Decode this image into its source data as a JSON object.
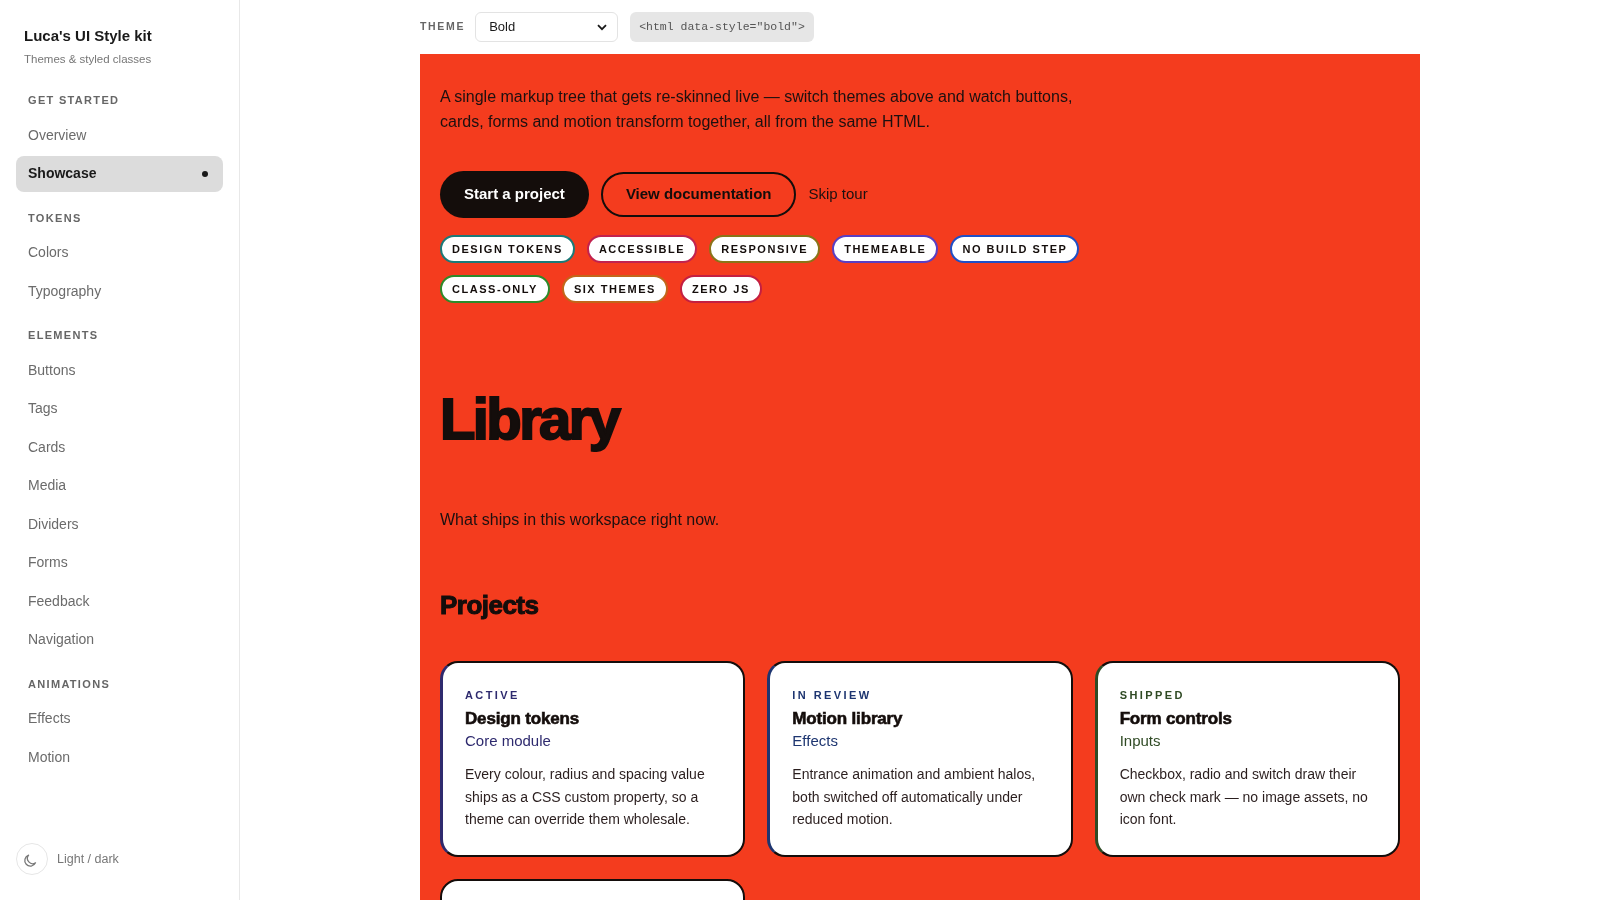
{
  "sidebar": {
    "title": "Luca's UI Style kit",
    "subtitle": "Themes & styled classes",
    "sections": [
      {
        "heading": "GET STARTED",
        "items": [
          {
            "label": "Overview",
            "selected": false
          },
          {
            "label": "Showcase",
            "selected": true
          }
        ]
      },
      {
        "heading": "TOKENS",
        "items": [
          {
            "label": "Colors",
            "selected": false
          },
          {
            "label": "Typography",
            "selected": false
          }
        ]
      },
      {
        "heading": "ELEMENTS",
        "items": [
          {
            "label": "Buttons",
            "selected": false
          },
          {
            "label": "Tags",
            "selected": false
          },
          {
            "label": "Cards",
            "selected": false
          },
          {
            "label": "Media",
            "selected": false
          },
          {
            "label": "Dividers",
            "selected": false
          },
          {
            "label": "Forms",
            "selected": false
          },
          {
            "label": "Feedback",
            "selected": false
          },
          {
            "label": "Navigation",
            "selected": false
          }
        ]
      },
      {
        "heading": "ANIMATIONS",
        "items": [
          {
            "label": "Effects",
            "selected": false
          },
          {
            "label": "Motion",
            "selected": false
          }
        ]
      }
    ],
    "theme_toggle": {
      "label": "Light / dark"
    }
  },
  "toolbar": {
    "theme_label": "THEME",
    "theme_select": {
      "value": "Bold"
    },
    "code": "<html data-style=\"bold\">"
  },
  "hero": {
    "intro": "A single markup tree that gets re-skinned live — switch themes above and watch buttons, cards, forms and motion transform together, all from the same HTML.",
    "buttons": [
      {
        "label": "Start a project",
        "kind": "primary"
      },
      {
        "label": "View documentation",
        "kind": "outline"
      },
      {
        "label": "Skip tour",
        "kind": "link"
      }
    ],
    "tags": [
      {
        "label": "DESIGN TOKENS",
        "color": "#1b7a78"
      },
      {
        "label": "ACCESSIBLE",
        "color": "#c2224f"
      },
      {
        "label": "RESPONSIVE",
        "color": "#8a7418"
      },
      {
        "label": "THEMEABLE",
        "color": "#5a3fc2"
      },
      {
        "label": "NO BUILD STEP",
        "color": "#1f4fc6"
      },
      {
        "label": "CLASS-ONLY",
        "color": "#2e8a2a"
      },
      {
        "label": "SIX THEMES",
        "color": "#c2661a"
      },
      {
        "label": "ZERO JS",
        "color": "#c41f42"
      }
    ]
  },
  "library": {
    "title": "Library",
    "subtitle": "What ships in this workspace right now."
  },
  "projects": {
    "heading": "Projects",
    "cards": [
      {
        "status": "ACTIVE",
        "title": "Design tokens",
        "category": "Core module",
        "description": "Every colour, radius and spacing value ships as a CSS custom property, so a theme can override them wholesale.",
        "color": "#2e2a6e"
      },
      {
        "status": "IN REVIEW",
        "title": "Motion library",
        "category": "Effects",
        "description": "Entrance animation and ambient halos, both switched off automatically under reduced motion.",
        "color": "#1d3570"
      },
      {
        "status": "SHIPPED",
        "title": "Form controls",
        "category": "Inputs",
        "description": "Checkbox, radio and switch draw their own check mark — no image assets, no icon font.",
        "color": "#2f4a24"
      }
    ]
  }
}
